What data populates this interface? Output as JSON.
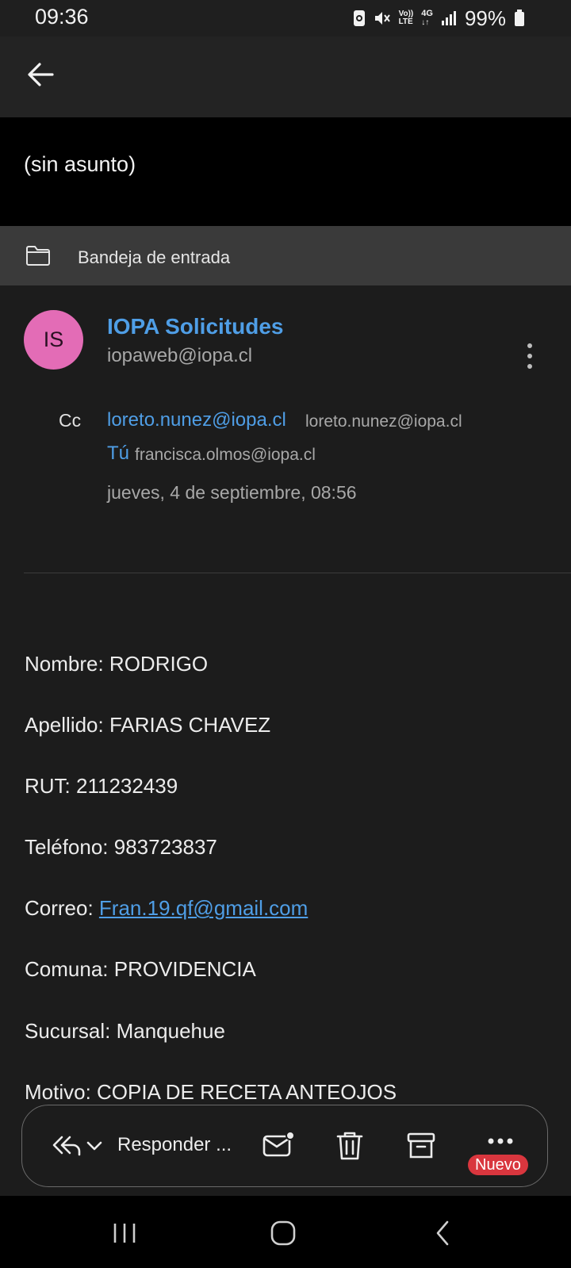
{
  "status_bar": {
    "time": "09:36",
    "battery": "99%",
    "network_voice": "Vo))",
    "network_lte": "LTE",
    "network_type": "4G",
    "icons": [
      "sync-icon",
      "mute-icon",
      "volte-icon",
      "4g-icon",
      "signal-icon",
      "battery-icon"
    ]
  },
  "header": {
    "back_icon": "arrow-left-icon"
  },
  "email": {
    "subject": "(sin asunto)",
    "folder": "Bandeja de entrada",
    "sender": {
      "initials": "IS",
      "name": "IOPA Solicitudes",
      "email": "iopaweb@iopa.cl",
      "avatar_color": "#e36cb6"
    },
    "cc_label": "Cc",
    "cc_name": "loreto.nunez@iopa.cl",
    "cc_address": "loreto.nunez@iopa.cl",
    "to_name": "Tú",
    "to_address": "francisca.olmos@iopa.cl",
    "date": "jueves, 4 de septiembre, 08:56",
    "body": {
      "nombre": "Nombre: RODRIGO",
      "apellido": "Apellido: FARIAS CHAVEZ",
      "rut": "RUT: 211232439",
      "telefono": "Teléfono: 983723837",
      "correo_label": "Correo: ",
      "correo_link": "Fran.19.qf@gmail.com",
      "comuna": "Comuna: PROVIDENCIA",
      "sucursal": "Sucursal: Manquehue",
      "motivo": "Motivo: COPIA DE RECETA ANTEOJOS"
    }
  },
  "actions": {
    "reply_label": "Responder ...",
    "badge": "Nuevo",
    "icons": [
      "reply-all-icon",
      "chevron-down-icon",
      "mark-unread-icon",
      "trash-icon",
      "archive-icon",
      "more-horizontal-icon"
    ]
  },
  "colors": {
    "accent_link": "#4f9ee6",
    "badge_red": "#d9363e",
    "background": "#1c1c1c"
  }
}
